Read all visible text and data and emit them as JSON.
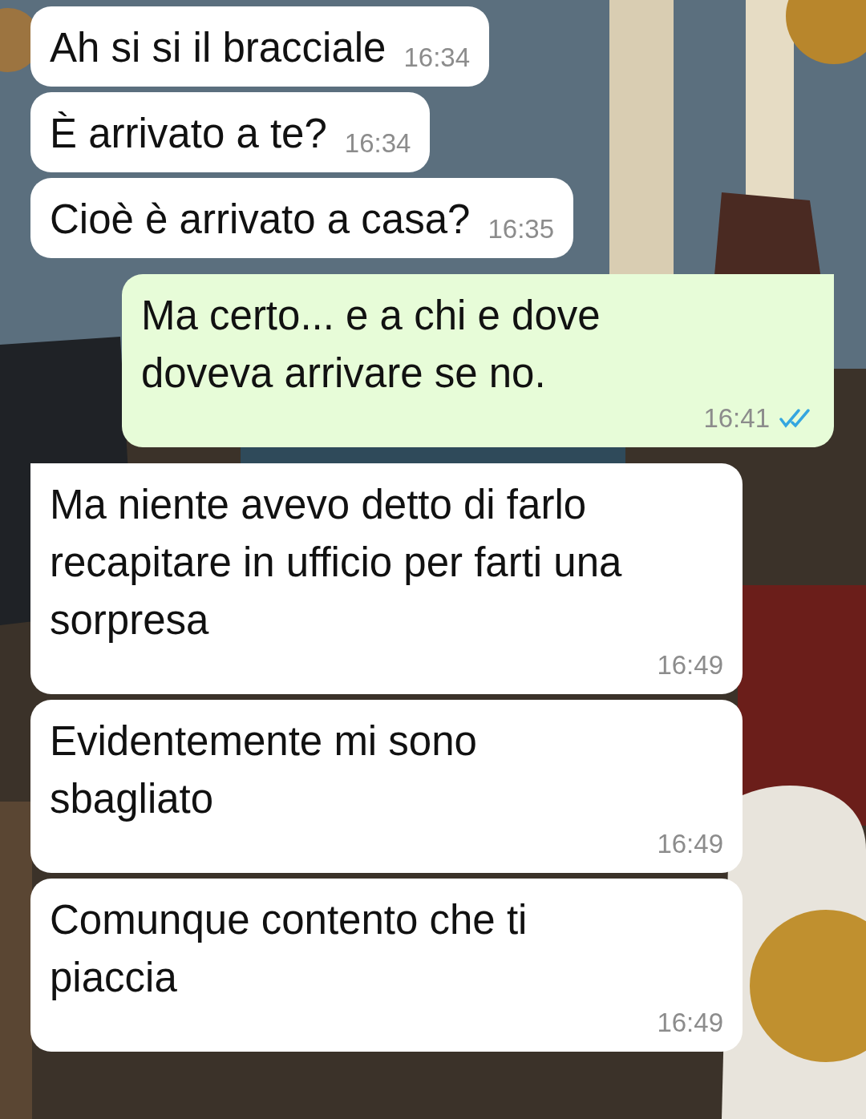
{
  "messages": [
    {
      "outgoing": false,
      "tail": false,
      "text": "Ah si si il bracciale",
      "time": "16:34"
    },
    {
      "outgoing": false,
      "tail": false,
      "text": "È arrivato a te?",
      "time": "16:34"
    },
    {
      "outgoing": false,
      "tail": false,
      "text": "Cioè è arrivato a casa?",
      "time": "16:35"
    },
    {
      "outgoing": true,
      "tail": true,
      "text": "Ma certo... e a chi e dove doveva arrivare se no.",
      "time": "16:41",
      "read": true
    },
    {
      "outgoing": false,
      "tail": true,
      "text": "Ma niente avevo detto di farlo recapitare in ufficio per farti una sorpresa",
      "time": "16:49"
    },
    {
      "outgoing": false,
      "tail": false,
      "text": "Evidentemente mi sono sbagliato",
      "time": "16:49"
    },
    {
      "outgoing": false,
      "tail": false,
      "text": "Comunque contento che ti piaccia",
      "time": "16:49"
    }
  ]
}
